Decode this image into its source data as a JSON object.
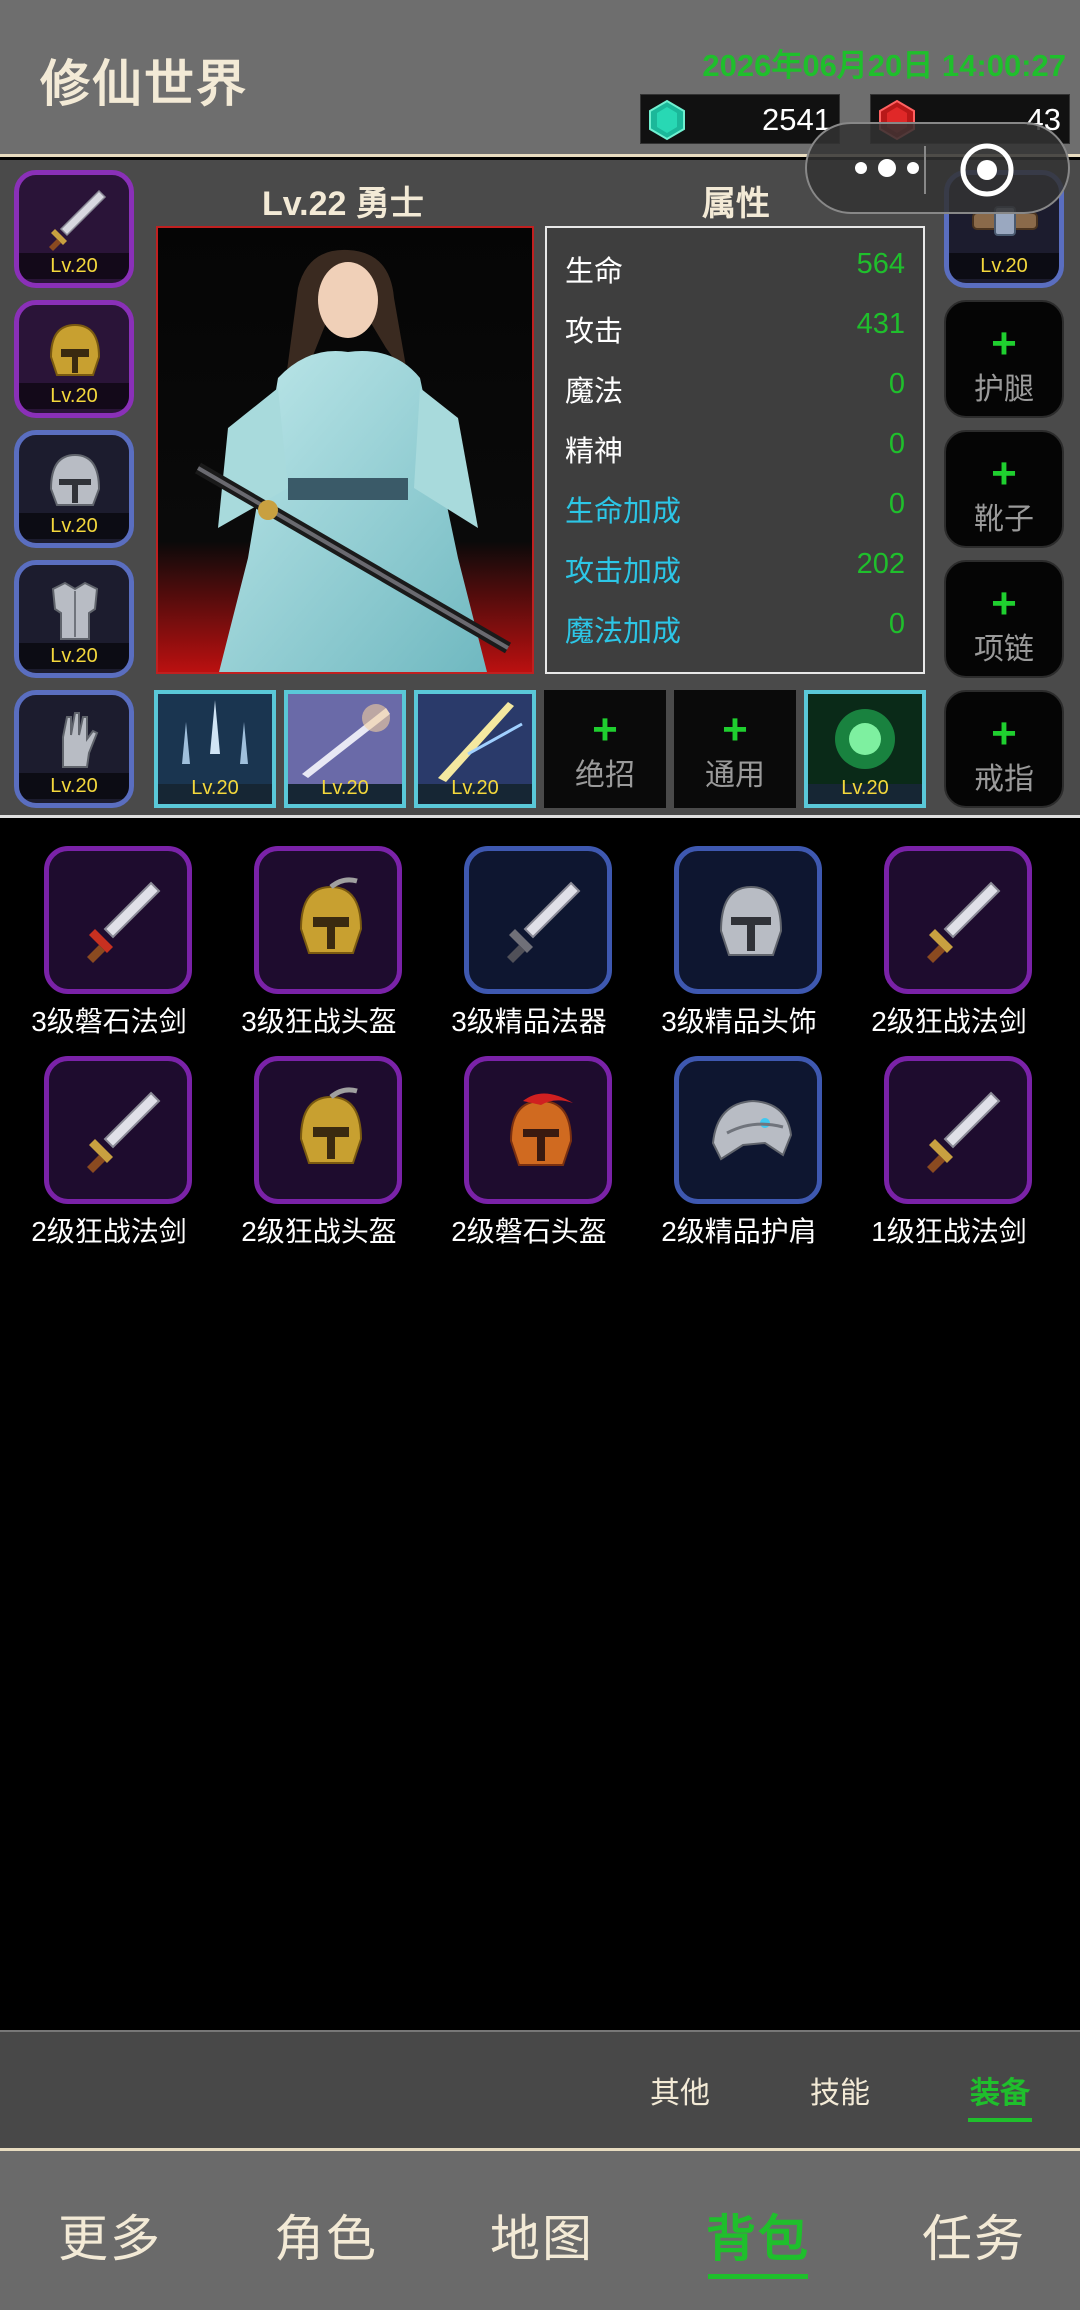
{
  "header": {
    "title": "修仙世界",
    "datetime": "2026年06月20日 14:00:27",
    "currency_green": "2541",
    "currency_red": "43"
  },
  "character": {
    "heading": "Lv.22 勇士",
    "stats_heading": "属性",
    "stats": [
      {
        "label": "生命",
        "value": "564"
      },
      {
        "label": "攻击",
        "value": "431"
      },
      {
        "label": "魔法",
        "value": "0"
      },
      {
        "label": "精神",
        "value": "0"
      },
      {
        "label": "生命加成",
        "value": "0"
      },
      {
        "label": "攻击加成",
        "value": "202"
      },
      {
        "label": "魔法加成",
        "value": "0"
      }
    ]
  },
  "left_slots": [
    {
      "icon": "sword-icon",
      "level": "Lv.20"
    },
    {
      "icon": "gold-helmet-icon",
      "level": "Lv.20"
    },
    {
      "icon": "steel-helmet-icon",
      "level": "Lv.20"
    },
    {
      "icon": "armor-icon",
      "level": "Lv.20"
    },
    {
      "icon": "gauntlet-icon",
      "level": "Lv.20"
    }
  ],
  "right_slots": {
    "belt_level": "Lv.20",
    "legs_label": "护腿",
    "boots_label": "靴子",
    "necklace_label": "项链",
    "ring_label": "戒指"
  },
  "skills": {
    "skill1_level": "Lv.20",
    "skill2_level": "Lv.20",
    "skill3_level": "Lv.20",
    "ultimate_label": "绝招",
    "general_label": "通用",
    "skill6_level": "Lv.20"
  },
  "inventory": [
    {
      "name": "3级磐石法剑",
      "icon": "sword-icon",
      "rarity": "purple"
    },
    {
      "name": "3级狂战头盔",
      "icon": "gold-helmet-icon",
      "rarity": "purple"
    },
    {
      "name": "3级精品法器",
      "icon": "sword-icon",
      "rarity": "blue"
    },
    {
      "name": "3级精品头饰",
      "icon": "steel-helmet-icon",
      "rarity": "blue"
    },
    {
      "name": "2级狂战法剑",
      "icon": "sword-icon",
      "rarity": "purple"
    },
    {
      "name": "2级狂战法剑",
      "icon": "sword-icon",
      "rarity": "purple"
    },
    {
      "name": "2级狂战头盔",
      "icon": "gold-helmet-icon",
      "rarity": "purple"
    },
    {
      "name": "2级磐石头盔",
      "icon": "red-helmet-icon",
      "rarity": "purple"
    },
    {
      "name": "2级精品护肩",
      "icon": "pauldron-icon",
      "rarity": "blue"
    },
    {
      "name": "1级狂战法剑",
      "icon": "sword-icon",
      "rarity": "purple"
    }
  ],
  "subtabs": {
    "other": "其他",
    "skills": "技能",
    "equipment": "装备"
  },
  "nav": {
    "more": "更多",
    "character": "角色",
    "map": "地图",
    "bag": "背包",
    "quests": "任务"
  }
}
